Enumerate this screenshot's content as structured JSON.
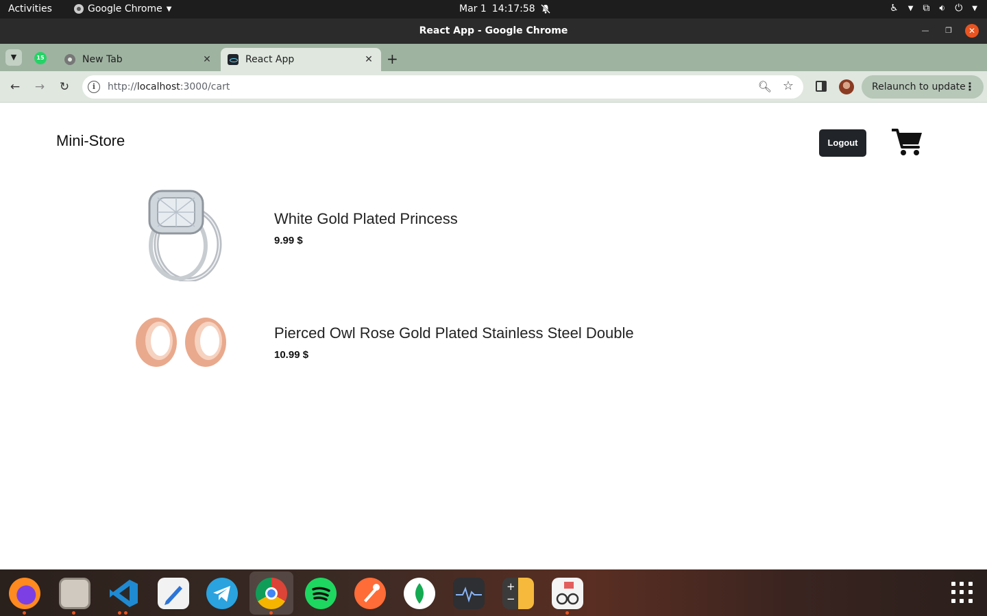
{
  "system_bar": {
    "activities": "Activities",
    "app_name": "Google Chrome",
    "date": "Mar 1",
    "time": "14:17:58"
  },
  "window": {
    "title": "React App - Google Chrome"
  },
  "tabs": [
    {
      "label": "New Tab",
      "active": false
    },
    {
      "label": "React App",
      "active": true
    }
  ],
  "whatsapp_badge": "15",
  "toolbar": {
    "url_prefix": "http://",
    "url_host": "localhost",
    "url_rest": ":3000/cart",
    "relaunch_label": "Relaunch to update"
  },
  "store": {
    "brand": "Mini-Store",
    "logout_label": "Logout"
  },
  "cart_items": [
    {
      "name": "White Gold Plated Princess",
      "price": "9.99 $",
      "image": "ring-icon"
    },
    {
      "name": "Pierced Owl Rose Gold Plated Stainless Steel Double",
      "price": "10.99 $",
      "image": "rose-gold-tunnels-icon"
    }
  ],
  "dock_apps": [
    "firefox",
    "files",
    "vscode",
    "text-editor",
    "telegram",
    "chrome",
    "spotify",
    "postman",
    "mongodb-compass",
    "system-monitor",
    "calculator",
    "document-viewer"
  ]
}
